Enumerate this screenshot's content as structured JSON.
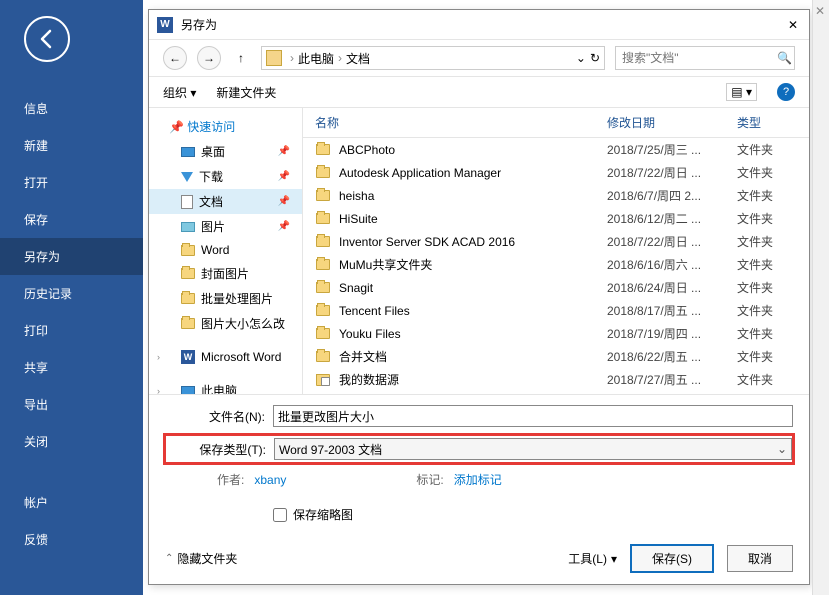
{
  "sidebar": {
    "items": [
      {
        "label": "信息"
      },
      {
        "label": "新建"
      },
      {
        "label": "打开"
      },
      {
        "label": "保存"
      },
      {
        "label": "另存为"
      },
      {
        "label": "历史记录"
      },
      {
        "label": "打印"
      },
      {
        "label": "共享"
      },
      {
        "label": "导出"
      },
      {
        "label": "关闭"
      }
    ],
    "bottom": [
      {
        "label": "帐户"
      },
      {
        "label": "反馈"
      }
    ]
  },
  "dialog": {
    "title": "另存为",
    "breadcrumb": {
      "pc": "此电脑",
      "loc": "文档"
    },
    "search_placeholder": "搜索\"文档\"",
    "toolbar": {
      "organize": "组织",
      "newfolder": "新建文件夹"
    },
    "columns": {
      "name": "名称",
      "date": "修改日期",
      "type": "类型"
    },
    "tree": {
      "quick": "快速访问",
      "desktop": "桌面",
      "downloads": "下载",
      "documents": "文档",
      "pictures": "图片",
      "word": "Word",
      "cover": "封面图片",
      "batch": "批量处理图片",
      "size": "图片大小怎么改",
      "msword": "Microsoft Word",
      "thispc": "此电脑"
    },
    "files": [
      {
        "name": "ABCPhoto",
        "date": "2018/7/25/周三 ...",
        "type": "文件夹",
        "ic": "folder"
      },
      {
        "name": "Autodesk Application Manager",
        "date": "2018/7/22/周日 ...",
        "type": "文件夹",
        "ic": "folder"
      },
      {
        "name": "heisha",
        "date": "2018/6/7/周四 2...",
        "type": "文件夹",
        "ic": "folder"
      },
      {
        "name": "HiSuite",
        "date": "2018/6/12/周二 ...",
        "type": "文件夹",
        "ic": "folder"
      },
      {
        "name": "Inventor Server SDK ACAD 2016",
        "date": "2018/7/22/周日 ...",
        "type": "文件夹",
        "ic": "folder"
      },
      {
        "name": "MuMu共享文件夹",
        "date": "2018/6/16/周六 ...",
        "type": "文件夹",
        "ic": "folder"
      },
      {
        "name": "Snagit",
        "date": "2018/6/24/周日 ...",
        "type": "文件夹",
        "ic": "folder"
      },
      {
        "name": "Tencent Files",
        "date": "2018/8/17/周五 ...",
        "type": "文件夹",
        "ic": "folder"
      },
      {
        "name": "Youku Files",
        "date": "2018/7/19/周四 ...",
        "type": "文件夹",
        "ic": "folder"
      },
      {
        "name": "合并文档",
        "date": "2018/6/22/周五 ...",
        "type": "文件夹",
        "ic": "folder"
      },
      {
        "name": "我的数据源",
        "date": "2018/7/27/周五 ...",
        "type": "文件夹",
        "ic": "db"
      }
    ],
    "filename_label": "文件名(N):",
    "filename_value": "批量更改图片大小",
    "filetype_label": "保存类型(T):",
    "filetype_value": "Word 97-2003 文档",
    "author_label": "作者:",
    "author_value": "xbany",
    "tags_label": "标记:",
    "tags_value": "添加标记",
    "thumb_label": "保存缩略图",
    "hide_label": "隐藏文件夹",
    "tools_label": "工具(L)",
    "save_label": "保存(S)",
    "cancel_label": "取消"
  }
}
